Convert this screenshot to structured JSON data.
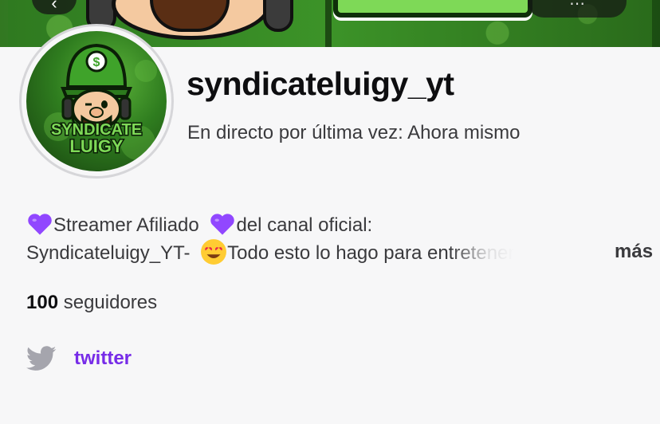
{
  "banner": {
    "back_icon": "chevron-left-icon",
    "more_icon": "more-icon"
  },
  "profile": {
    "username": "syndicateluigy_yt",
    "last_live": "En directo por última vez: Ahora mismo",
    "avatar_text_top": "SYNDICATE",
    "avatar_text_bottom": "LUIGY"
  },
  "bio": {
    "part1": "Streamer Afiliado",
    "part2": "del canal oficial:",
    "part3": "Syndicateluigy_YT-",
    "part4": "Todo esto lo hago para entretener",
    "more": "más",
    "heart_color": "#9147ff"
  },
  "stats": {
    "followers_count": "100",
    "followers_label": "seguidores"
  },
  "social": {
    "icon": "twitter-icon",
    "label": "twitter",
    "color": "#772ce8"
  }
}
